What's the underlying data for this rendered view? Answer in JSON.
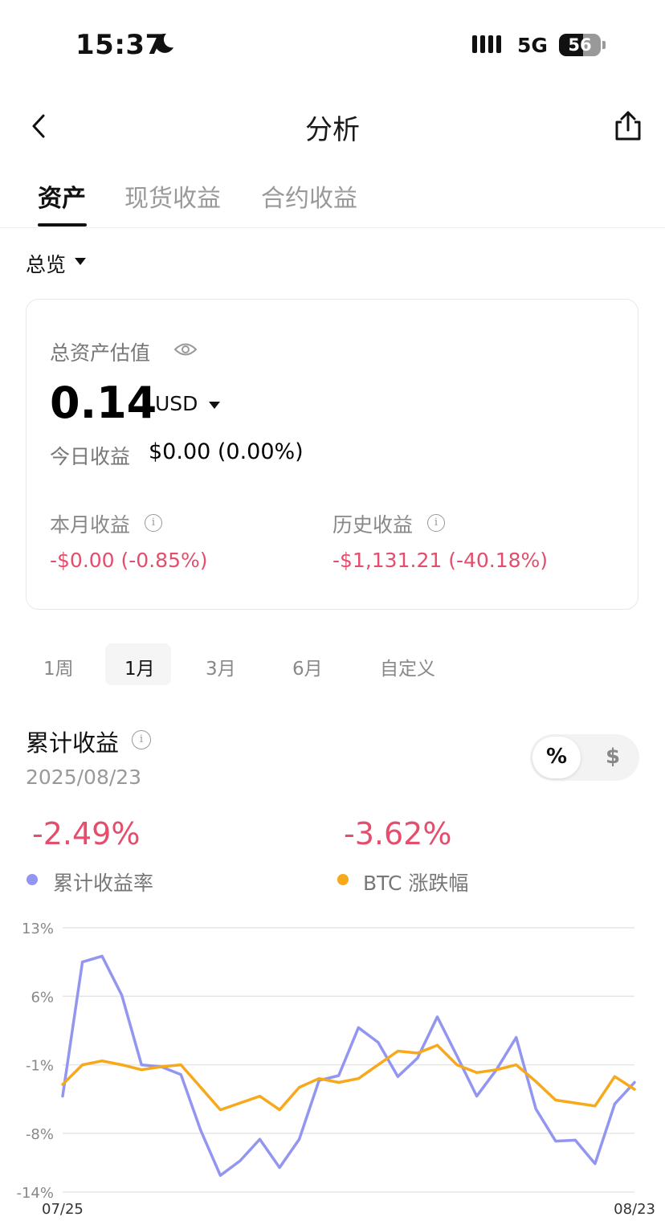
{
  "status_bar": {
    "time": "15:37",
    "network": "5G",
    "battery": "56"
  },
  "header": {
    "title": "分析"
  },
  "tabs": [
    {
      "label": "资产",
      "active": true
    },
    {
      "label": "现货收益",
      "active": false
    },
    {
      "label": "合约收益",
      "active": false
    }
  ],
  "overview": {
    "label": "总览"
  },
  "card": {
    "label": "总资产估值",
    "amount": "0.14",
    "currency": "USD",
    "today_label": "今日收益",
    "today_value": "$0.00 (0.00%)",
    "month_label": "本月收益",
    "month_value": "-$0.00 (-0.85%)",
    "history_label": "历史收益",
    "history_value": "-$1,131.21 (-40.18%)"
  },
  "periods": [
    {
      "label": "1周",
      "active": false
    },
    {
      "label": "1月",
      "active": true
    },
    {
      "label": "3月",
      "active": false
    },
    {
      "label": "6月",
      "active": false
    },
    {
      "label": "自定义",
      "active": false
    }
  ],
  "cumulative": {
    "title": "累计收益",
    "date": "2025/08/23",
    "toggle_pct": "%",
    "toggle_usd": "$",
    "value_1": "-2.49%",
    "value_2": "-3.62%",
    "legend_1": "累计收益率",
    "legend_2": "BTC 涨跌幅"
  },
  "colors": {
    "series_1": "#9296f0",
    "series_2": "#f7a81b",
    "negative": "#e54d6c"
  },
  "chart_data": {
    "type": "line",
    "x_start_label": "07/25",
    "x_end_label": "08/23",
    "y_ticks": [
      "13%",
      "6%",
      "-1%",
      "-8%",
      "-14%"
    ],
    "y_tick_values": [
      13,
      6,
      -1,
      -8,
      -14
    ],
    "ylim": [
      -14,
      13
    ],
    "grid": true,
    "series": [
      {
        "name": "累计收益率",
        "color": "#9296f0",
        "values": [
          -4.2,
          9.5,
          10.1,
          6.1,
          -1.0,
          -1.2,
          -2.0,
          -7.7,
          -12.3,
          -10.8,
          -8.6,
          -11.5,
          -8.6,
          -2.6,
          -2.1,
          2.8,
          1.3,
          -2.2,
          -0.3,
          3.9,
          -0.1,
          -4.2,
          -1.5,
          1.8,
          -5.5,
          -8.8,
          -8.7,
          -11.1,
          -5.0,
          -2.8
        ]
      },
      {
        "name": "BTC 涨跌幅",
        "color": "#f7a81b",
        "values": [
          -3.0,
          -1.0,
          -0.6,
          -1.0,
          -1.5,
          -1.2,
          -1.0,
          -3.3,
          -5.6,
          -4.9,
          -4.2,
          -5.6,
          -3.3,
          -2.4,
          -2.8,
          -2.4,
          -1.0,
          0.4,
          0.2,
          1.0,
          -1.0,
          -1.8,
          -1.5,
          -1.0,
          -2.7,
          -4.6,
          -4.9,
          -5.2,
          -2.2,
          -3.5
        ]
      }
    ]
  }
}
